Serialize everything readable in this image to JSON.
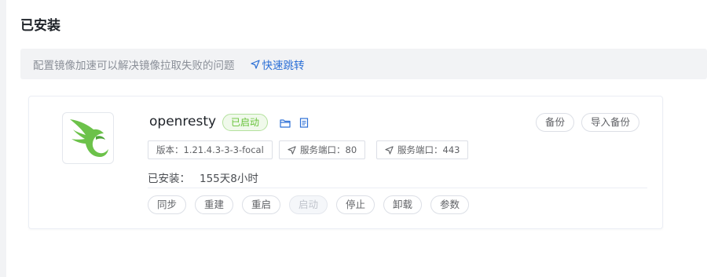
{
  "page": {
    "title": "已安装"
  },
  "notice": {
    "text": "配置镜像加速可以解决镜像拉取失败的问题",
    "link_label": "快速跳转"
  },
  "app": {
    "name": "openresty",
    "status": "已启动",
    "version_tag": "版本：1.21.4.3-3-3-focal",
    "ports": [
      {
        "label": "服务端口：80"
      },
      {
        "label": "服务端口：443"
      }
    ],
    "installed_label": "已安装：",
    "installed_duration": "155天8小时",
    "header_buttons": {
      "backup": "备份",
      "import_backup": "导入备份"
    },
    "actions": {
      "sync": "同步",
      "rebuild": "重建",
      "restart": "重启",
      "start": "启动",
      "stop": "停止",
      "uninstall": "卸载",
      "params": "参数"
    }
  },
  "colors": {
    "accent": "#2b6fd6",
    "running_green": "#67c23a",
    "logo_green": "#6cc24a"
  },
  "icons": {
    "notice_link": "navigation-arrow-icon",
    "folder": "folder-icon",
    "doc": "document-icon",
    "port": "navigation-arrow-icon",
    "logo": "openresty-logo"
  }
}
